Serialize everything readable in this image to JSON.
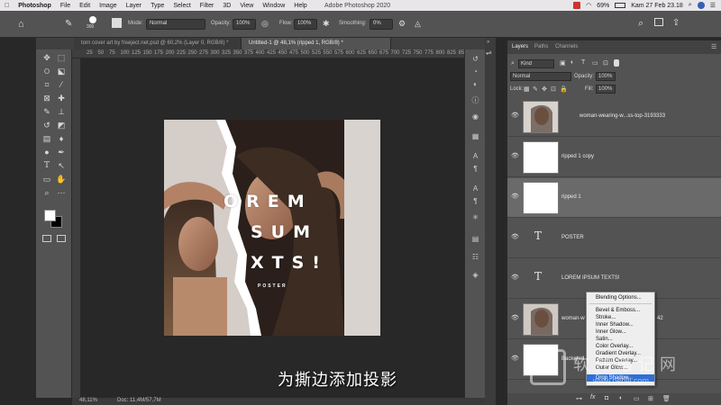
{
  "menubar": {
    "apple": "",
    "app": "Photoshop",
    "items": [
      "File",
      "Edit",
      "Image",
      "Layer",
      "Type",
      "Select",
      "Filter",
      "3D",
      "View",
      "Window",
      "Help"
    ],
    "window_title": "Adobe Photoshop 2020",
    "battery": "69%",
    "clock": "Kam 27 Feb 23.18"
  },
  "options": {
    "brush_size": "300",
    "mode_label": "Mode:",
    "mode_value": "Normal",
    "opacity_label": "Opacity:",
    "opacity_value": "100%",
    "flow_label": "Flow:",
    "flow_value": "100%",
    "smoothing_label": "Smoothing:",
    "smoothing_value": "0%"
  },
  "tabs": [
    {
      "label": "torn cover art by freeject.net.psd @ 60,2% (Layer 0, RGB/8) *"
    },
    {
      "label": "Untitled-1 @ 48,1% (ripped 1, RGB/8) *"
    }
  ],
  "ruler": [
    "25",
    "50",
    "75",
    "100",
    "125",
    "150",
    "175",
    "200",
    "225",
    "250",
    "275",
    "300",
    "325",
    "350",
    "375",
    "400",
    "425",
    "450",
    "475",
    "500",
    "525",
    "550",
    "575",
    "600",
    "625",
    "650",
    "675",
    "700",
    "725",
    "750",
    "775",
    "800",
    "825",
    "850",
    "875",
    "900",
    "925"
  ],
  "poster": {
    "line1": "OREM",
    "line2": "SUM",
    "line3": "XTS!",
    "small": "POSTER"
  },
  "status": {
    "zoom": "48,11%",
    "doc": "Doc: 11,4M/57,7M"
  },
  "layers_panel": {
    "tabs": [
      "Layers",
      "Paths",
      "Channels"
    ],
    "kind_label": "Kind",
    "blend_mode": "Normal",
    "opacity_label": "Opacity:",
    "opacity_value": "100%",
    "lock_label": "Lock:",
    "fill_label": "Fill:",
    "fill_value": "100%",
    "layers": [
      {
        "name": "woman-wearing-w...ss-top-3193333",
        "type": "smart"
      },
      {
        "name": "ripped 1 copy",
        "type": "pixel"
      },
      {
        "name": "ripped 1",
        "type": "pixel",
        "selected": true
      },
      {
        "name": "POSTER",
        "type": "text"
      },
      {
        "name": "LOREM IPSUM TEXTS!",
        "type": "text"
      },
      {
        "name": "woman-w",
        "type": "smart",
        "suffix": "42"
      },
      {
        "name": "Backgrou",
        "type": "pixel"
      }
    ]
  },
  "context_menu": {
    "items": [
      {
        "label": "Blending Options...",
        "highlight": false,
        "sep_after": true
      },
      {
        "label": "Bevel & Emboss...",
        "highlight": false
      },
      {
        "label": "Stroke...",
        "highlight": false
      },
      {
        "label": "Inner Shadow...",
        "highlight": false
      },
      {
        "label": "Inner Glow...",
        "highlight": false
      },
      {
        "label": "Satin...",
        "highlight": false
      },
      {
        "label": "Color Overlay...",
        "highlight": false
      },
      {
        "label": "Gradient Overlay...",
        "highlight": false
      },
      {
        "label": "Pattern Overlay...",
        "highlight": false
      },
      {
        "label": "Outer Glow...",
        "highlight": false
      },
      {
        "label": "Drop Shadow...",
        "highlight": true
      }
    ]
  },
  "subtitle": "为撕边添加投影",
  "watermark": {
    "cn": "软件笔记网",
    "url": "www.pebiji.com"
  },
  "colors": {
    "menu_highlight": "#2f6fd6",
    "panel_bg": "#535353",
    "canvas_bg": "#282828"
  }
}
